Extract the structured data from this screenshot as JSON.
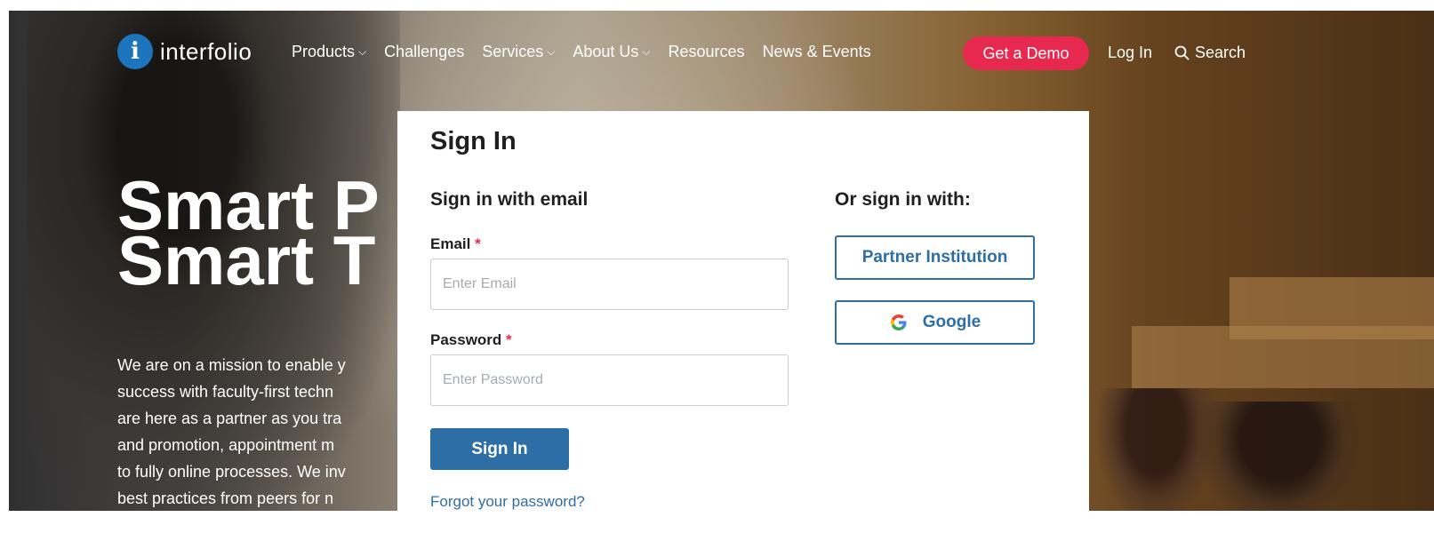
{
  "nav": {
    "logo_text": "interfolio",
    "logo_mark": "i",
    "links": [
      {
        "label": "Products",
        "has_caret": true
      },
      {
        "label": "Challenges",
        "has_caret": false
      },
      {
        "label": "Services",
        "has_caret": true
      },
      {
        "label": "About Us",
        "has_caret": true
      },
      {
        "label": "Resources",
        "has_caret": false
      },
      {
        "label": "News & Events",
        "has_caret": false
      }
    ],
    "caret_glyph": "⌵",
    "demo_label": "Get a Demo",
    "login_label": "Log In",
    "search_label": "Search"
  },
  "hero": {
    "title_line1": "Smart P",
    "title_line2": "Smart T",
    "body_lines": [
      "We are on a mission to enable y",
      "success with faculty-first techn",
      "are here as a partner as you tra",
      "and promotion, appointment m",
      "to fully online processes. We inv",
      "best practices from peers for n"
    ]
  },
  "signin": {
    "title": "Sign In",
    "email_section": "Sign in with email",
    "email_label": "Email",
    "email_placeholder": "Enter Email",
    "password_label": "Password",
    "password_placeholder": "Enter Password",
    "required_mark": "*",
    "submit_label": "Sign In",
    "forgot_label": "Forgot your password?",
    "alt_section": "Or sign in with:",
    "partner_label": "Partner Institution",
    "google_label": "Google"
  },
  "colors": {
    "brand_blue": "#1c75bc",
    "demo_red": "#e8294f",
    "button_blue": "#2e6ea6"
  },
  "icons": [
    "search-icon",
    "chevron-down-icon",
    "google-icon",
    "interfolio-logo-icon"
  ]
}
